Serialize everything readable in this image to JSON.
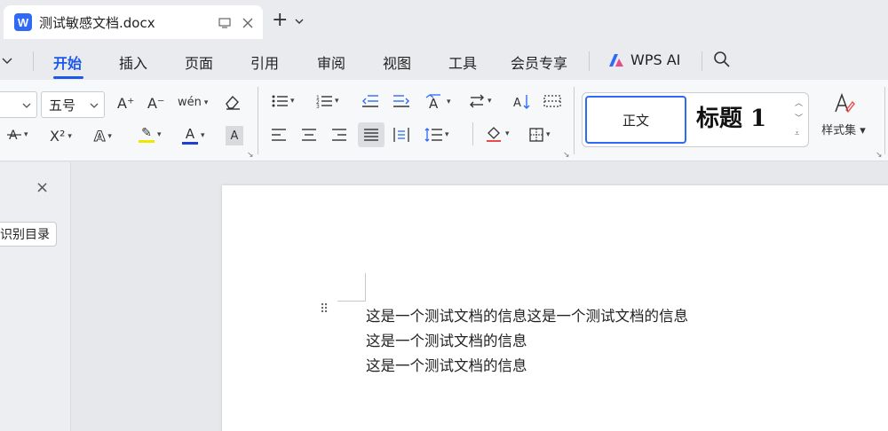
{
  "app": {
    "logo_letter": "W",
    "brand_color": "#2f6af7",
    "accent_color": "#1d58e8"
  },
  "tab": {
    "title": "测试敏感文档.docx",
    "icons": [
      "monitor-icon",
      "close-icon"
    ]
  },
  "new_tab": {
    "plus": "+",
    "chevron": "⌄"
  },
  "menu": {
    "items": [
      "开始",
      "插入",
      "页面",
      "引用",
      "审阅",
      "视图",
      "工具",
      "会员专享",
      "WPS AI"
    ],
    "active": "开始",
    "search_icon": "search-icon"
  },
  "ribbon": {
    "font_size": "五号",
    "labels": {
      "grow_font": "A⁺",
      "shrink_font": "A⁻",
      "pinyin": "wén",
      "superscript": "X²",
      "text_effect": "A",
      "highlight": "✎",
      "font_color": "A",
      "char_shading": "A"
    },
    "styles": {
      "normal": "正文",
      "heading1": "标题 1",
      "styleset": "样式集"
    }
  },
  "nav": {
    "close": "×",
    "identify_toc": "识别目录"
  },
  "document": {
    "lines": [
      "这是一个测试文档的信息这是一个测试文档的信息",
      "这是一个测试文档的信息",
      "这是一个测试文档的信息"
    ]
  }
}
